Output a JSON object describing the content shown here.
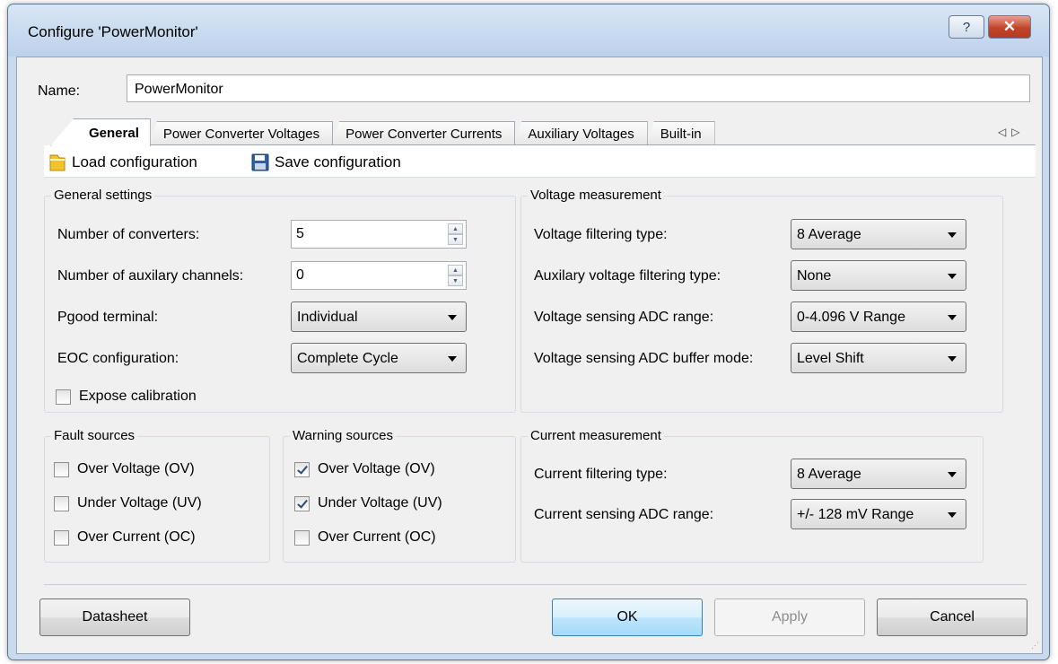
{
  "window": {
    "title": "Configure 'PowerMonitor'",
    "help_glyph": "?",
    "close_glyph": "✕"
  },
  "name": {
    "label": "Name:",
    "value": "PowerMonitor"
  },
  "tabs": [
    {
      "label": "General"
    },
    {
      "label": "Power Converter Voltages"
    },
    {
      "label": "Power Converter Currents"
    },
    {
      "label": "Auxiliary Voltages"
    },
    {
      "label": "Built-in"
    }
  ],
  "tab_scroll": {
    "left": "◁",
    "right": "▷"
  },
  "toolbar": {
    "load_label": "Load configuration",
    "save_label": "Save configuration"
  },
  "general_settings": {
    "legend": "General settings",
    "num_converters_label": "Number of converters:",
    "num_converters_value": "5",
    "num_aux_label": "Number of auxilary channels:",
    "num_aux_value": "0",
    "pgood_label": "Pgood terminal:",
    "pgood_value": "Individual",
    "eoc_label": "EOC configuration:",
    "eoc_value": "Complete Cycle",
    "expose_calibration_label": "Expose calibration",
    "expose_calibration_checked": false
  },
  "voltage_measurement": {
    "legend": "Voltage measurement",
    "filter_label": "Voltage filtering type:",
    "filter_value": "8 Average",
    "aux_filter_label": "Auxilary voltage filtering type:",
    "aux_filter_value": "None",
    "adc_range_label": "Voltage sensing ADC range:",
    "adc_range_value": "0-4.096 V Range",
    "buffer_mode_label": "Voltage sensing ADC buffer mode:",
    "buffer_mode_value": "Level Shift"
  },
  "fault_sources": {
    "legend": "Fault sources",
    "ov_label": "Over Voltage (OV)",
    "ov_checked": false,
    "uv_label": "Under Voltage (UV)",
    "uv_checked": false,
    "oc_label": "Over Current (OC)",
    "oc_checked": false
  },
  "warning_sources": {
    "legend": "Warning sources",
    "ov_label": "Over Voltage (OV)",
    "ov_checked": true,
    "uv_label": "Under Voltage (UV)",
    "uv_checked": true,
    "oc_label": "Over Current (OC)",
    "oc_checked": false
  },
  "current_measurement": {
    "legend": "Current measurement",
    "filter_label": "Current filtering type:",
    "filter_value": "8 Average",
    "adc_range_label": "Current sensing ADC range:",
    "adc_range_value": "+/- 128 mV Range"
  },
  "buttons": {
    "datasheet": "Datasheet",
    "ok": "OK",
    "apply": "Apply",
    "cancel": "Cancel"
  },
  "colors": {
    "window_frame": "#c9daed",
    "client_bg": "#f0f0f0",
    "close_button": "#c2432a",
    "default_button_border": "#3c7fb1"
  }
}
